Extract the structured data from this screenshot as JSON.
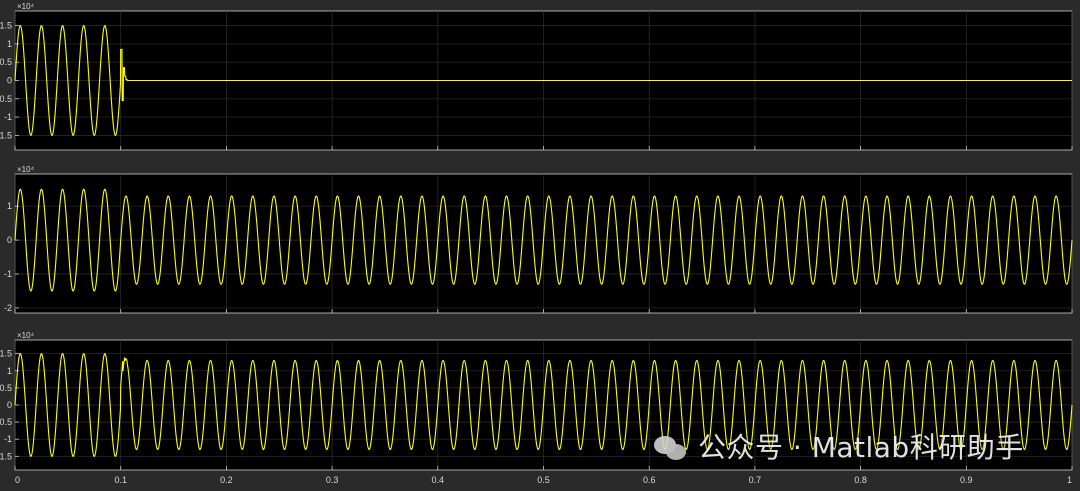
{
  "app": {
    "title": ""
  },
  "colors": {
    "background": "#2a2a2a",
    "plot_bg": "#000000",
    "grid": "#2f2f2f",
    "axis": "#cfcfcf",
    "signal": "#ffff00"
  },
  "watermark": {
    "label": "公众号 · Matlab科研助手",
    "icon": "wechat-icon"
  },
  "chart_data": [
    {
      "type": "line",
      "title": "",
      "xlabel": "",
      "ylabel": "",
      "exponent": "×10⁴",
      "xlim": [
        0,
        1
      ],
      "ylim": [
        -1.9,
        1.9
      ],
      "grid": true,
      "xticks": [
        0,
        0.1,
        0.2,
        0.3,
        0.4,
        0.5,
        0.6,
        0.7,
        0.8,
        0.9,
        1
      ],
      "xtick_labels": [],
      "yticks": [
        -1.5,
        -1,
        -0.5,
        0,
        0.5,
        1,
        1.5
      ],
      "ytick_labels": [
        "-1.5",
        "-1",
        "-0.5",
        "0",
        "0.5",
        "1",
        "1.5"
      ],
      "series": [
        {
          "name": "",
          "kind": "sine",
          "frequency": 50,
          "segments": [
            {
              "x0": 0.0,
              "x1": 0.1,
              "amp": 1.5,
              "offset": 0.0,
              "phase": 0.0
            },
            {
              "x0": 0.1,
              "x1": 1.0,
              "amp": 0.0,
              "offset": 0.0,
              "phase": 0.0
            }
          ],
          "transients": [
            {
              "x": 0.1,
              "values": [
                0.85,
                -0.55,
                0.35,
                0.12,
                0.03,
                0.0
              ]
            }
          ]
        }
      ]
    },
    {
      "type": "line",
      "title": "",
      "xlabel": "",
      "ylabel": "",
      "exponent": "×10⁴",
      "xlim": [
        0,
        1
      ],
      "ylim": [
        -2.15,
        1.95
      ],
      "grid": true,
      "xticks": [
        0,
        0.1,
        0.2,
        0.3,
        0.4,
        0.5,
        0.6,
        0.7,
        0.8,
        0.9,
        1
      ],
      "xtick_labels": [],
      "yticks": [
        -2,
        -1,
        0,
        1
      ],
      "ytick_labels": [
        "-2",
        "-1",
        "0",
        "1"
      ],
      "series": [
        {
          "name": "",
          "kind": "sine",
          "frequency": 50,
          "segments": [
            {
              "x0": 0.0,
              "x1": 0.1,
              "amp": 1.5,
              "offset": 0.0,
              "phase": 0.0
            },
            {
              "x0": 0.1,
              "x1": 1.0,
              "amp": 1.3,
              "offset": 0.0,
              "phase": 0.0
            }
          ],
          "transients": []
        }
      ]
    },
    {
      "type": "line",
      "title": "",
      "xlabel": "",
      "ylabel": "",
      "exponent": "×10⁴",
      "xlim": [
        0,
        1
      ],
      "ylim": [
        -1.9,
        1.9
      ],
      "grid": true,
      "xticks": [
        0,
        0.1,
        0.2,
        0.3,
        0.4,
        0.5,
        0.6,
        0.7,
        0.8,
        0.9,
        1
      ],
      "xtick_labels": [
        "0",
        "0.1",
        "0.2",
        "0.3",
        "0.4",
        "0.5",
        "0.6",
        "0.7",
        "0.8",
        "0.9",
        "1"
      ],
      "yticks": [
        -1.5,
        -1,
        -0.5,
        0,
        0.5,
        1,
        1.5
      ],
      "ytick_labels": [
        "-1.5",
        "-1",
        "-0.5",
        "0",
        "0.5",
        "1",
        "1.5"
      ],
      "series": [
        {
          "name": "",
          "kind": "sine",
          "frequency": 50,
          "segments": [
            {
              "x0": 0.0,
              "x1": 0.1,
              "amp": 1.5,
              "offset": 0.0,
              "phase": 0.0
            },
            {
              "x0": 0.1,
              "x1": 1.0,
              "amp": 1.3,
              "offset": 0.0,
              "phase": 0.0
            }
          ],
          "transients": [
            {
              "x": 0.1,
              "values": [
                0.55,
                0.18,
                0.05,
                0.0
              ]
            }
          ]
        }
      ]
    }
  ]
}
